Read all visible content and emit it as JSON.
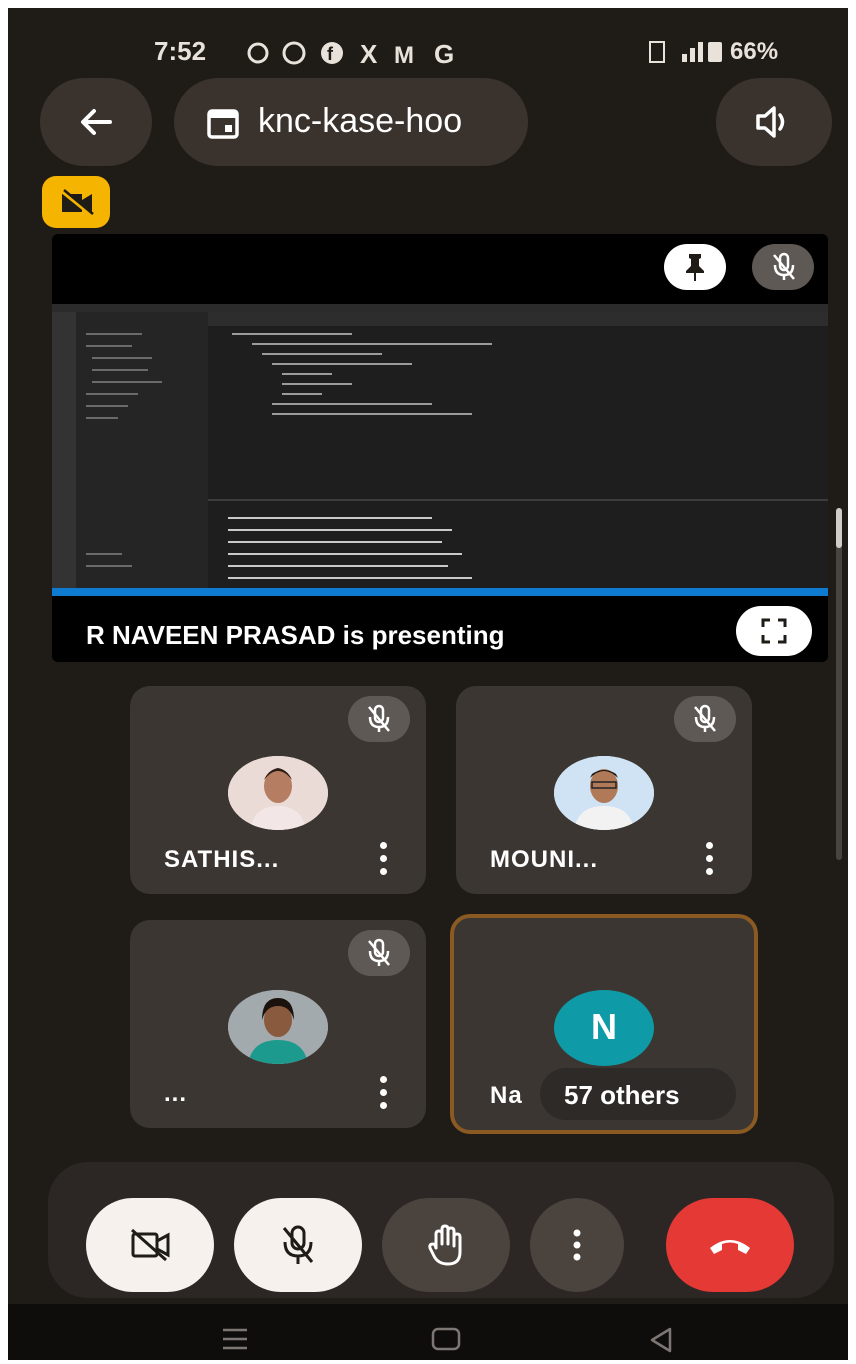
{
  "status_bar": {
    "time": "7:52",
    "notification_icons": [
      "sync-icon",
      "whatsapp-icon",
      "facebook-icon",
      "x-icon",
      "gmail-icon",
      "google-icon"
    ],
    "battery": "66%"
  },
  "header": {
    "meeting_code": "knc-kase-hoo",
    "back_icon": "arrow-left-icon",
    "calendar_icon": "calendar-icon",
    "speaker_icon": "speaker-icon"
  },
  "camera_off_badge": "camera-off-icon",
  "presentation": {
    "presenter_text": "R NAVEEN PRASAD is presenting",
    "pin_icon": "pin-icon",
    "mute_icon": "mic-off-icon",
    "fullscreen_icon": "fullscreen-icon"
  },
  "participants": [
    {
      "name": "SATHIS...",
      "muted": true
    },
    {
      "name": "MOUNI...",
      "muted": true
    },
    {
      "name": "...",
      "muted": true
    },
    {
      "name": "Na",
      "initial": "N",
      "others_label": "57 others",
      "highlighted": true
    }
  ],
  "controls": {
    "camera": "camera-off-icon",
    "mic": "mic-off-icon",
    "raise_hand": "hand-icon",
    "more": "more-vert-icon",
    "end_call": "phone-hangup-icon"
  },
  "colors": {
    "background": "#1f1b17",
    "tile": "#3b3632",
    "end_call": "#e53935",
    "initial_avatar": "#0f9aa8",
    "camera_badge": "#f5b400",
    "highlight_border": "#8a5a22"
  }
}
